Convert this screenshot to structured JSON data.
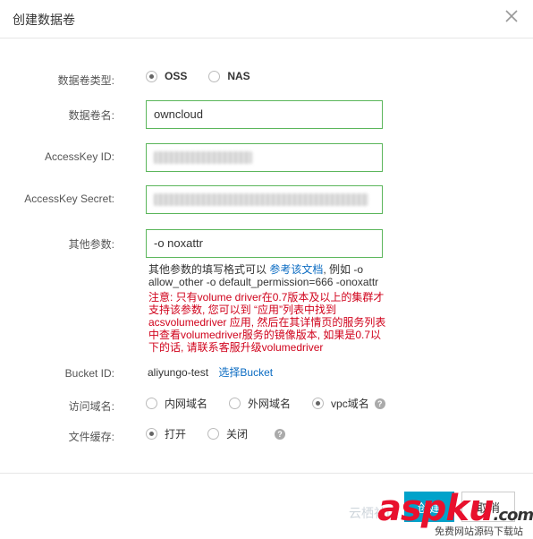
{
  "dialog": {
    "title": "创建数据卷",
    "close_icon": "close-icon"
  },
  "form": {
    "type": {
      "label": "数据卷类型:",
      "options": [
        {
          "label": "OSS",
          "checked": true
        },
        {
          "label": "NAS",
          "checked": false
        }
      ]
    },
    "name": {
      "label": "数据卷名:",
      "value": "owncloud"
    },
    "access_key_id": {
      "label": "AccessKey ID:",
      "value": ""
    },
    "access_key_secret": {
      "label": "AccessKey Secret:",
      "value": ""
    },
    "other_params": {
      "label": "其他参数:",
      "value": "-o noxattr",
      "hint_prefix": "其他参数的填写格式可以",
      "hint_link": "参考该文档",
      "hint_suffix": ", 例如 -o allow_other -o default_permission=666 -onoxattr",
      "warning": "注意: 只有volume driver在0.7版本及以上的集群才支持该参数, 您可以到 “应用”列表中找到acsvolumedriver 应用, 然后在其详情页的服务列表中查看volumedriver服务的镜像版本, 如果是0.7以下的话, 请联系客服升级volumedriver"
    },
    "bucket": {
      "label": "Bucket ID:",
      "value": "aliyungo-test",
      "link": "选择Bucket"
    },
    "domain": {
      "label": "访问域名:",
      "options": [
        {
          "label": "内网域名",
          "checked": false
        },
        {
          "label": "外网域名",
          "checked": false
        },
        {
          "label": "vpc域名",
          "checked": true
        }
      ]
    },
    "cache": {
      "label": "文件缓存:",
      "options": [
        {
          "label": "打开",
          "checked": true
        },
        {
          "label": "关闭",
          "checked": false
        }
      ]
    }
  },
  "footer": {
    "confirm_label": "创建",
    "cancel_label": "取消"
  },
  "watermark": {
    "main": "aspku",
    "suffix": ".com",
    "sub": "免费网站源码下载站",
    "left": "云栖社区"
  },
  "colors": {
    "input_border": "#5bb65b",
    "link": "#0a6bc2",
    "warning": "#d0021b",
    "primary": "#00a2ca"
  }
}
